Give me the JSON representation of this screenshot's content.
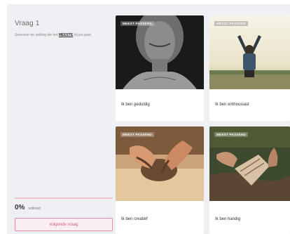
{
  "question": {
    "title": "Vraag 1",
    "instruction_prefix": "Selecteer de stelling die het",
    "instruction_emphasis": "MEESTE",
    "instruction_suffix": "bij jou past."
  },
  "progress": {
    "percent_label": "0%",
    "label": "voltooid",
    "fraction": 0.0
  },
  "next_button_label": "volgende vraag",
  "cards": [
    {
      "badge": "MEEST PASSEND",
      "caption": "Ik ben geduldig"
    },
    {
      "badge": "MEEST PASSEND",
      "caption": "Ik ben enthousiast"
    },
    {
      "badge": "MEEST PASSEND",
      "caption": "Ik ben creatief"
    },
    {
      "badge": "MEEST PASSEND",
      "caption": "Ik ben handig"
    }
  ],
  "colors": {
    "accent": "#e0758f",
    "panel_background": "#eff0f3"
  }
}
